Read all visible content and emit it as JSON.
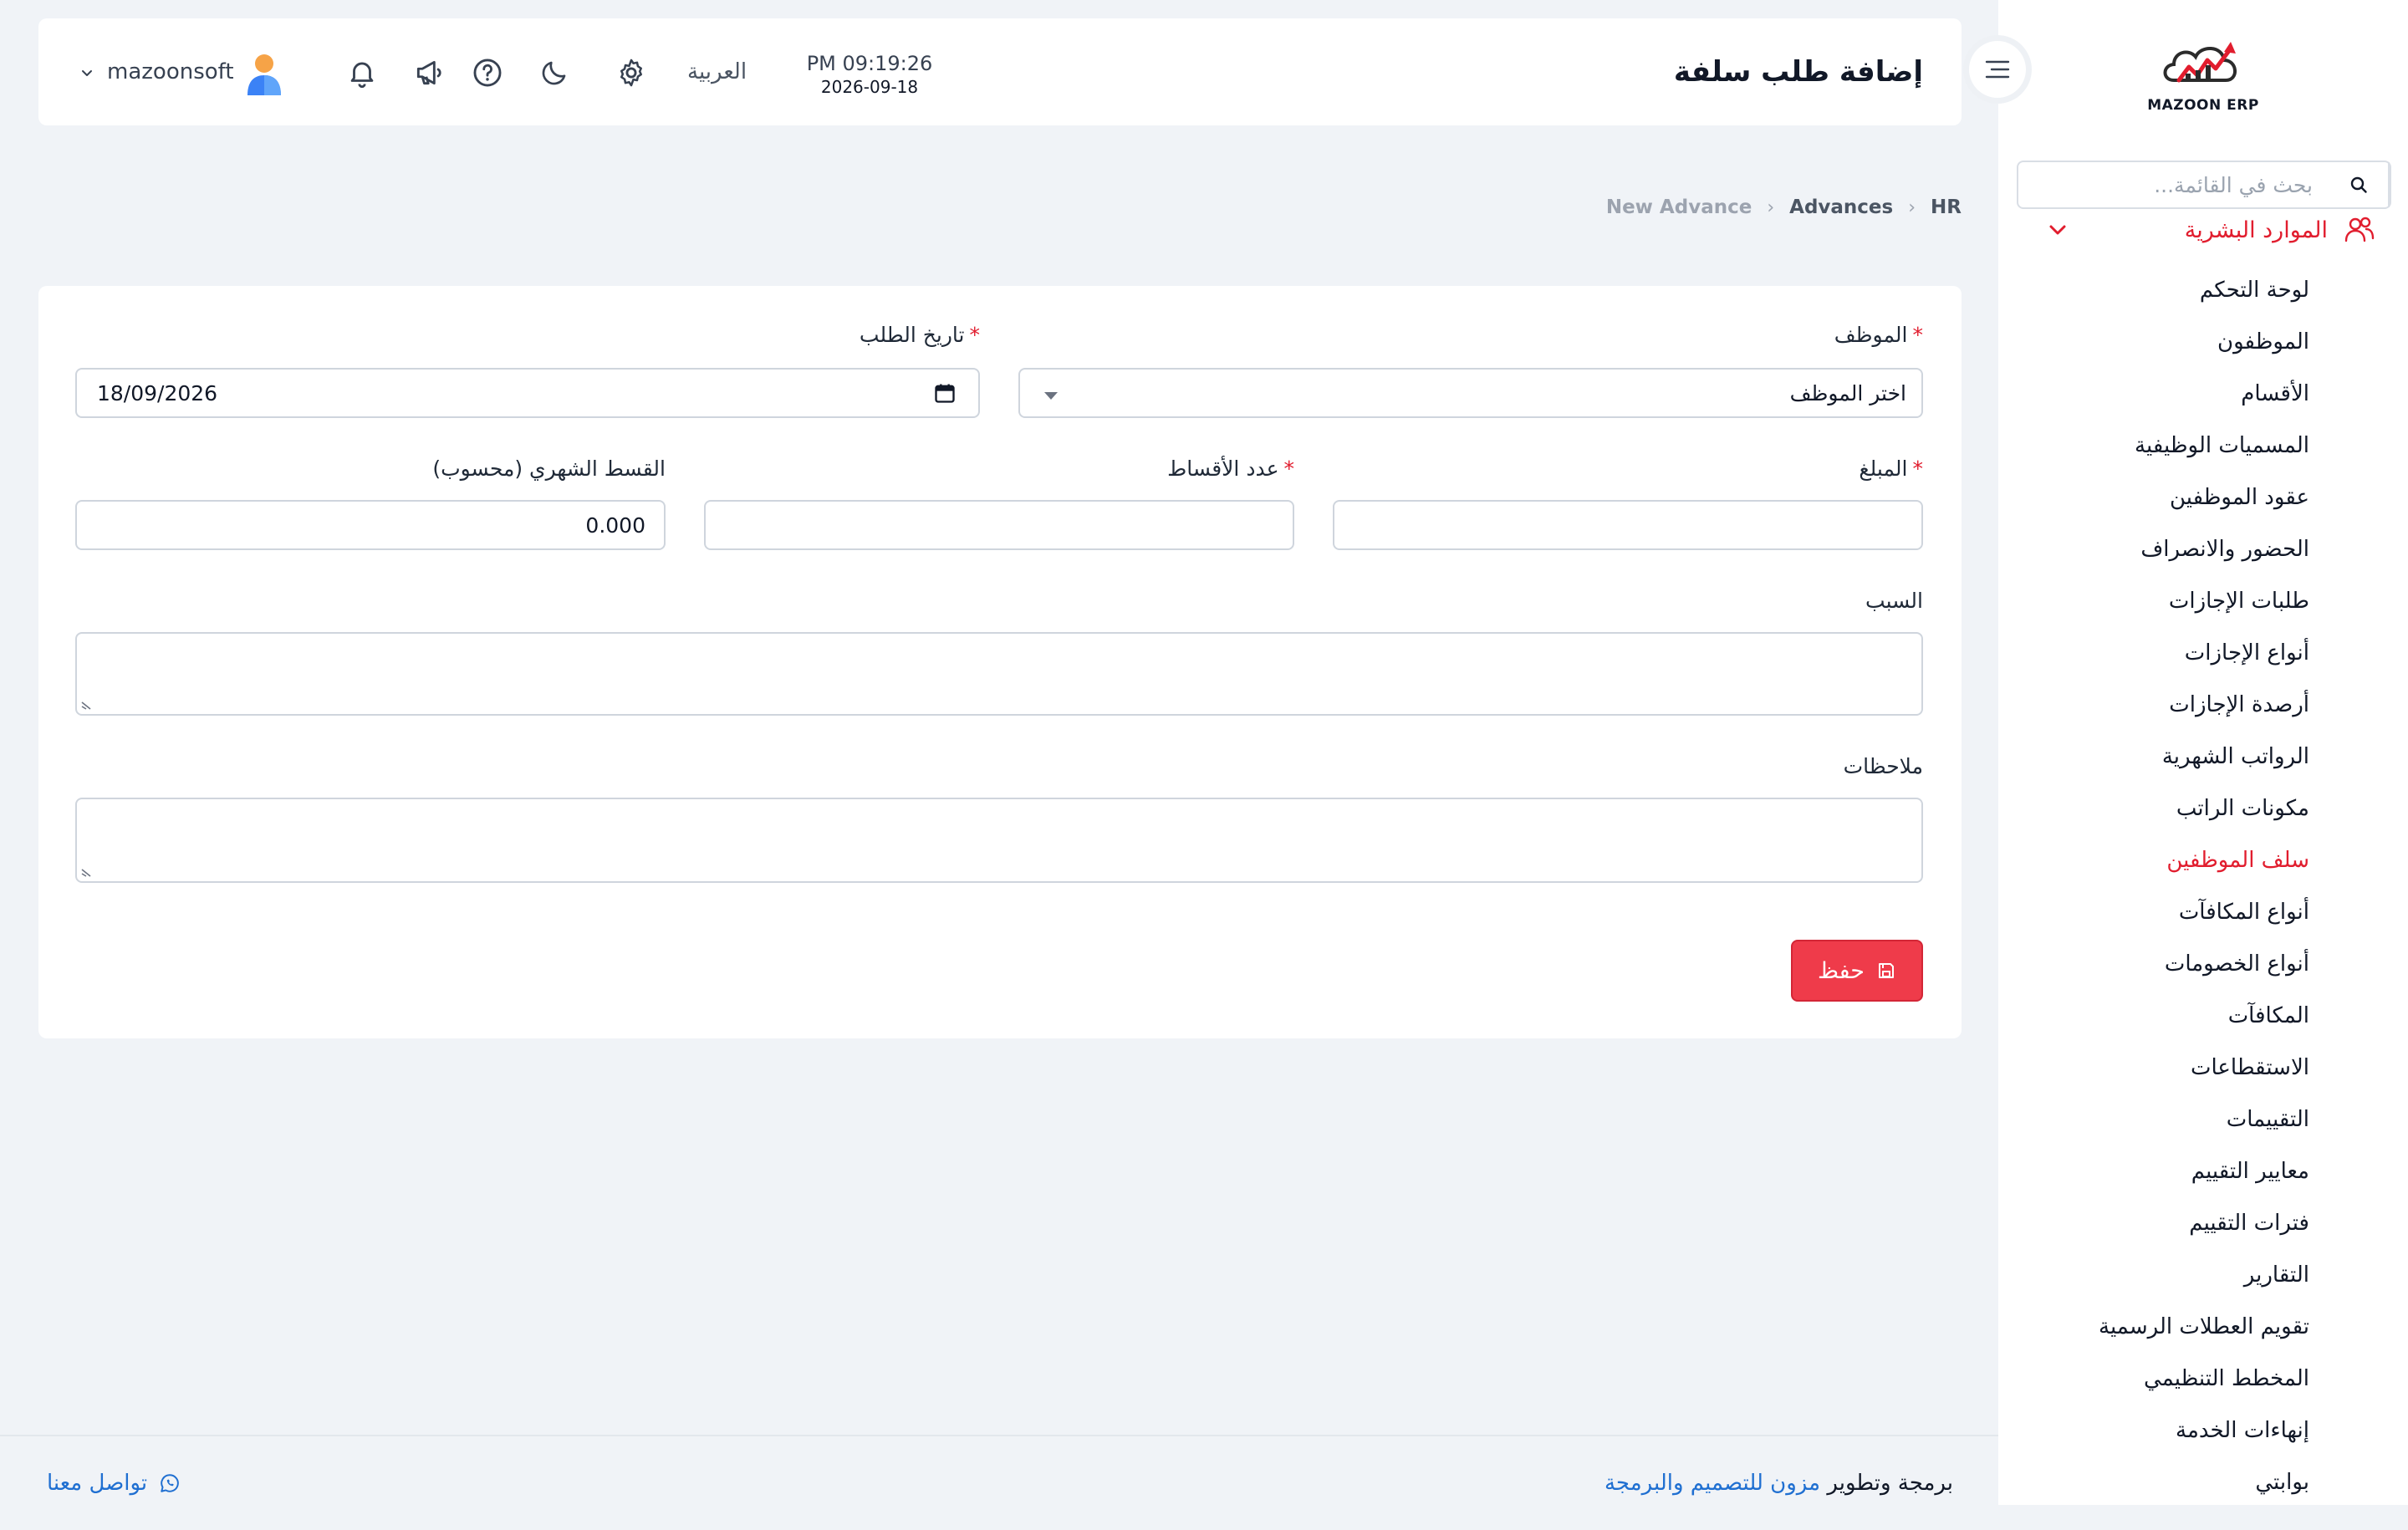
{
  "header": {
    "title": "إضافة طلب سلفة",
    "time": "PM 09:19:26",
    "date": "2026-09-18",
    "language": "العربية",
    "user_name": "mazoonsoft"
  },
  "sidebar": {
    "logo_text": "MAZOON ERP",
    "search_placeholder": "بحث في القائمة...",
    "section_label": "الموارد البشرية",
    "items": [
      {
        "label": "لوحة التحكم"
      },
      {
        "label": "الموظفون"
      },
      {
        "label": "الأقسام"
      },
      {
        "label": "المسميات الوظيفية"
      },
      {
        "label": "عقود الموظفين"
      },
      {
        "label": "الحضور والانصراف"
      },
      {
        "label": "طلبات الإجازات"
      },
      {
        "label": "أنواع الإجازات"
      },
      {
        "label": "أرصدة الإجازات"
      },
      {
        "label": "الرواتب الشهرية"
      },
      {
        "label": "مكونات الراتب"
      },
      {
        "label": "سلف الموظفين"
      },
      {
        "label": "أنواع المكافآت"
      },
      {
        "label": "أنواع الخصومات"
      },
      {
        "label": "المكافآت"
      },
      {
        "label": "الاستقطاعات"
      },
      {
        "label": "التقييمات"
      },
      {
        "label": "معايير التقييم"
      },
      {
        "label": "فترات التقييم"
      },
      {
        "label": "التقارير"
      },
      {
        "label": "تقويم العطلات الرسمية"
      },
      {
        "label": "المخطط التنظيمي"
      },
      {
        "label": "إنهاءات الخدمة"
      },
      {
        "label": "بوابتي"
      }
    ],
    "active_item": "سلف الموظفين"
  },
  "breadcrumb": {
    "items": [
      "HR",
      "Advances",
      "New Advance"
    ]
  },
  "form": {
    "employee": {
      "label": "الموظف",
      "required_mark": "*",
      "placeholder": "اختر الموظف"
    },
    "request_date": {
      "label": "تاريخ الطلب",
      "required_mark": "*",
      "value": "18/09/2026"
    },
    "amount": {
      "label": "المبلغ",
      "required_mark": "*",
      "value": ""
    },
    "installments": {
      "label": "عدد الأقساط",
      "required_mark": "*",
      "value": ""
    },
    "monthly_installment": {
      "label": "القسط الشهري (محسوب)",
      "value": "0.000"
    },
    "reason": {
      "label": "السبب",
      "value": ""
    },
    "notes": {
      "label": "ملاحظات",
      "value": ""
    },
    "save_label": "حفظ"
  },
  "footer": {
    "credit_prefix": "برمجة وتطوير",
    "credit_company": "مزون للتصميم والبرمجة",
    "contact_label": "تواصل معنا"
  },
  "colors": {
    "accent": "#ef3b4a",
    "link": "#1f6fd1",
    "active_nav": "#e11d2e"
  }
}
